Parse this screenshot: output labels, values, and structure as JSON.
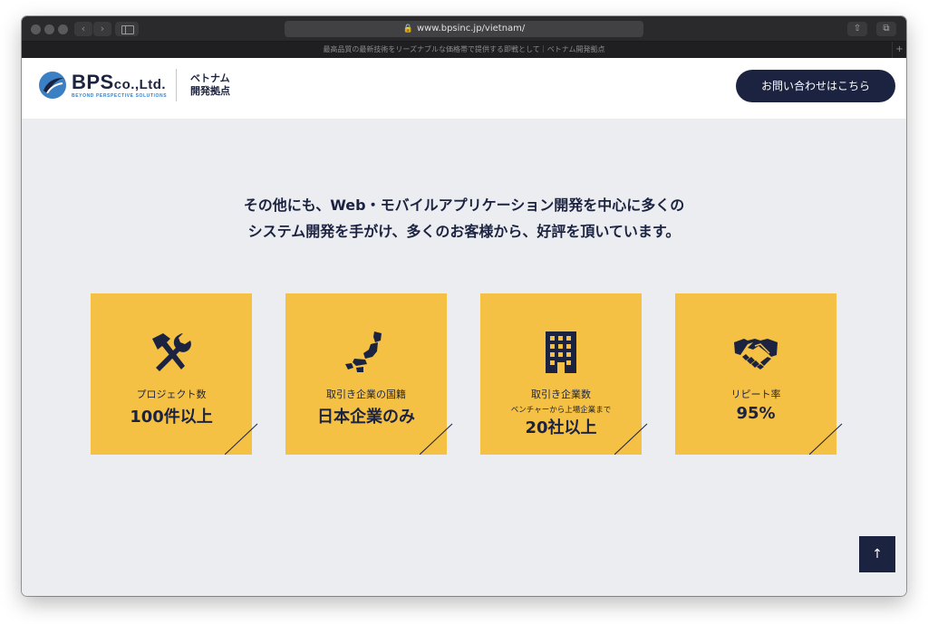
{
  "browser": {
    "url": "www.bpsinc.jp/vietnam/",
    "tab_title": "最高品質の最新技術をリーズナブルな価格帯で提供する即戦として｜ベトナム開発拠点",
    "back_glyph": "‹",
    "forward_glyph": "›",
    "lock_glyph": "🔒",
    "reader_glyph": "☰",
    "add_glyph": "+",
    "share_glyph": "⇧",
    "tabs_glyph": "⧉",
    "new_tab_glyph": "+"
  },
  "header": {
    "logo_text": "BPS",
    "logo_suffix": "co.,Ltd.",
    "logo_tagline": "BEYOND PERSPECTIVE SOLUTIONS",
    "site_name_line1": "ベトナム",
    "site_name_line2": "開発拠点",
    "contact_label": "お問い合わせはこちら"
  },
  "intro": {
    "line1": "その他にも、Web・モバイルアプリケーション開発を中心に多くの",
    "line2": "システム開発を手がけ、多くのお客様から、好評を頂いています。"
  },
  "stats": [
    {
      "label": "プロジェクト数",
      "sub": "",
      "value": "100件以上",
      "icon": "tools-icon"
    },
    {
      "label": "取引き企業の国籍",
      "sub": "",
      "value": "日本企業のみ",
      "icon": "japan-map-icon"
    },
    {
      "label": "取引き企業数",
      "sub": "ベンチャーから上場企業まで",
      "value": "20社以上",
      "icon": "building-icon"
    },
    {
      "label": "リピート率",
      "sub": "",
      "value": "95%",
      "icon": "handshake-icon"
    }
  ],
  "back_to_top": {
    "label": "↑"
  },
  "colors": {
    "navy": "#1c2340",
    "card_yellow": "#f4c144",
    "page_bg": "#ebedf1",
    "logo_blue": "#3b7fc4"
  }
}
